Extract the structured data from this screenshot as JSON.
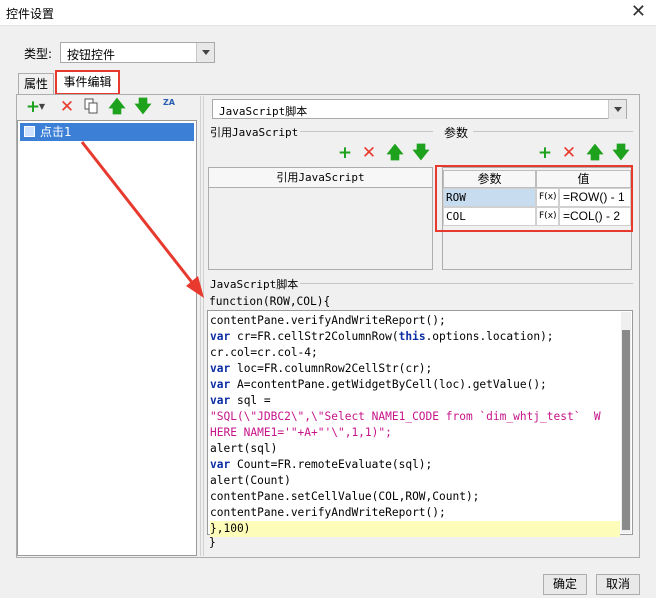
{
  "window": {
    "title": "控件设置",
    "close_glyph": "✕"
  },
  "type_row": {
    "label": "类型:",
    "value": "按钮控件"
  },
  "tabs": [
    {
      "label": "属性"
    },
    {
      "label": "事件编辑"
    }
  ],
  "events": {
    "items": [
      {
        "label": "点击1"
      }
    ]
  },
  "left_toolbar": {
    "icons": [
      "add-icon",
      "dropdown-icon",
      "delete-icon",
      "copy-icon",
      "move-up-icon",
      "move-down-icon",
      "sort-az-icon"
    ],
    "sort_label": "ZA"
  },
  "script_type": {
    "value": "JavaScript脚本"
  },
  "ref_section": {
    "title": "引用JavaScript",
    "column": "引用JavaScript"
  },
  "param_section": {
    "title": "参数",
    "columns": [
      "参数",
      "值"
    ],
    "rows": [
      {
        "name": "ROW",
        "fx": "F(x)",
        "value": "=ROW() - 1"
      },
      {
        "name": "COL",
        "fx": "F(x)",
        "value": "=COL() - 2"
      }
    ]
  },
  "script_section": {
    "title": "JavaScript脚本",
    "header": "function(ROW,COL){",
    "footer": "}",
    "lines": [
      [
        {
          "t": "contentPane.verifyAndWriteReport();"
        }
      ],
      [
        {
          "t": "var",
          "k": "kw"
        },
        {
          "t": " cr=FR.cellStr2ColumnRow("
        },
        {
          "t": "this",
          "k": "kw"
        },
        {
          "t": ".options.location);"
        }
      ],
      [
        {
          "t": "cr.col=cr.col-4;"
        }
      ],
      [
        {
          "t": "var",
          "k": "kw"
        },
        {
          "t": " loc=FR.columnRow2CellStr(cr);"
        }
      ],
      [
        {
          "t": "var",
          "k": "kw"
        },
        {
          "t": " A=contentPane.getWidgetByCell(loc).getValue();"
        }
      ],
      [
        {
          "t": "var",
          "k": "kw"
        },
        {
          "t": " sql ="
        }
      ],
      [
        {
          "t": "\"SQL(\\\"JDBC2\\\",\\\"Select NAME1_CODE from `dim_whtj_test`  W",
          "k": "str"
        }
      ],
      [
        {
          "t": "HERE NAME1='\"+A+\"'\\\",1,1)\";",
          "k": "str"
        }
      ],
      [
        {
          "t": "alert(sql)"
        }
      ],
      [
        {
          "t": "var",
          "k": "kw"
        },
        {
          "t": " Count=FR.remoteEvaluate(sql);"
        }
      ],
      [
        {
          "t": "alert(Count)"
        }
      ],
      [
        {
          "t": "contentPane.setCellValue(COL,ROW,Count);"
        }
      ],
      [
        {
          "t": "contentPane.verifyAndWriteReport();"
        }
      ],
      [
        {
          "t": "},100)"
        }
      ]
    ]
  },
  "buttons": {
    "ok": "确定",
    "cancel": "取消"
  },
  "colors": {
    "accent_red": "#e8392e",
    "selection_blue": "#3b7fd6",
    "icon_green": "#1ea21e",
    "keyword_blue": "#0b2da4",
    "string_magenta": "#c6148a"
  }
}
